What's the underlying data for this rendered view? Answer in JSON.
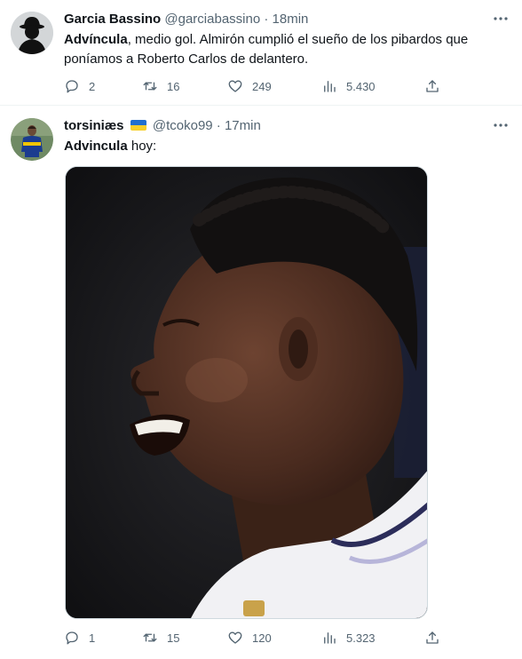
{
  "tweets": [
    {
      "name": "Garcia Bassino",
      "handle": "@garciabassino",
      "separator": "·",
      "time": "18min",
      "text_bold": "Advíncula",
      "text_rest": ", medio gol. Almirón cumplió el sueño de los pibardos que poníamos a Roberto Carlos de delantero.",
      "reply_count": "2",
      "retweet_count": "16",
      "like_count": "249",
      "view_count": "5.430"
    },
    {
      "name": "torsiniæs",
      "handle": "@tcoko99",
      "separator": "·",
      "time": "17min",
      "text_bold": "Advincula",
      "text_rest": " hoy:",
      "reply_count": "1",
      "retweet_count": "15",
      "like_count": "120",
      "view_count": "5.323"
    }
  ],
  "colors": {
    "text": "#0f1419",
    "secondary": "#536471",
    "divider": "#eff3f4",
    "flag_blue": "#1f6fd1",
    "flag_yellow": "#f7d02c"
  },
  "icons": [
    "more-icon",
    "reply-icon",
    "retweet-icon",
    "like-icon",
    "views-icon",
    "share-icon",
    "ukraine-flag-icon"
  ]
}
